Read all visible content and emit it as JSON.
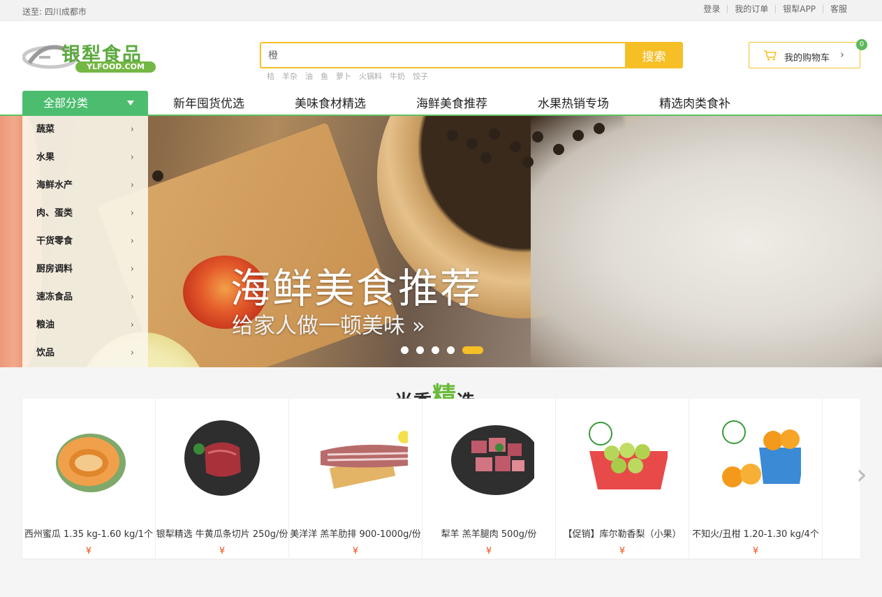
{
  "topbar": {
    "ship_to": "送至: 四川成都市",
    "links": [
      "登录",
      "我的订单",
      "银犁APP",
      "客服"
    ]
  },
  "header": {
    "logo_name": "银犁食品",
    "logo_url": "YLFOOD.COM",
    "search_value": "橙",
    "search_button": "搜索",
    "hot_words": [
      "桔",
      "羊杂",
      "油",
      "鱼",
      "萝卜",
      "火锅料",
      "牛奶",
      "饺子"
    ],
    "cart_label": "我的购物车",
    "cart_count": "0"
  },
  "nav": {
    "all_categories": "全部分类",
    "links": [
      "新年囤货优选",
      "美味食材精选",
      "海鲜美食推荐",
      "水果热销专场",
      "精选肉类食补"
    ]
  },
  "categories": [
    "蔬菜",
    "水果",
    "海鲜水产",
    "肉、蛋类",
    "干货零食",
    "厨房调料",
    "速冻食品",
    "粮油",
    "饮品"
  ],
  "banner": {
    "headline": "海鲜美食推荐",
    "subline": "给家人做一顿美味 »",
    "slide_count": 5,
    "active_slide": 5
  },
  "section": {
    "title_part1": "当季",
    "title_big": "精",
    "title_part2": "选"
  },
  "products": [
    {
      "title": "西州蜜瓜 1.35 kg-1.60 kg/1个",
      "price": "¥",
      "icon": "melon-image"
    },
    {
      "title": "银犁精选 牛黄瓜条切片 250g/份",
      "price": "¥",
      "icon": "beef-image"
    },
    {
      "title": "美洋洋 羔羊肋排 900-1000g/份",
      "price": "¥",
      "icon": "lamb-ribs-image"
    },
    {
      "title": "犁羊 羔羊腿肉 500g/份",
      "price": "¥",
      "icon": "lamb-leg-image"
    },
    {
      "title": "【促销】库尔勒香梨（小果）",
      "price": "¥",
      "icon": "pear-basket-image"
    },
    {
      "title": "不知火/丑柑 1.20-1.30 kg/4个",
      "price": "¥",
      "icon": "orange-basket-image"
    }
  ],
  "colors": {
    "accent_yellow": "#f6bf26",
    "accent_green": "#4cbd6f",
    "price_red": "#e8541e"
  }
}
